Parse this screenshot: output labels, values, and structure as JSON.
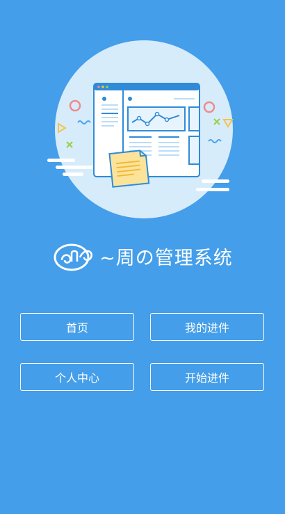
{
  "app": {
    "title": "~周の管理系统"
  },
  "menu": {
    "home": "首页",
    "my_shipments": "我的进件",
    "personal_center": "个人中心",
    "start_shipment": "开始进件"
  },
  "colors": {
    "background": "#449eea",
    "button_border": "#ffffff",
    "text": "#ffffff"
  },
  "icons": {
    "logo": "swirl-logo-icon",
    "hero": "dashboard-illustration"
  }
}
